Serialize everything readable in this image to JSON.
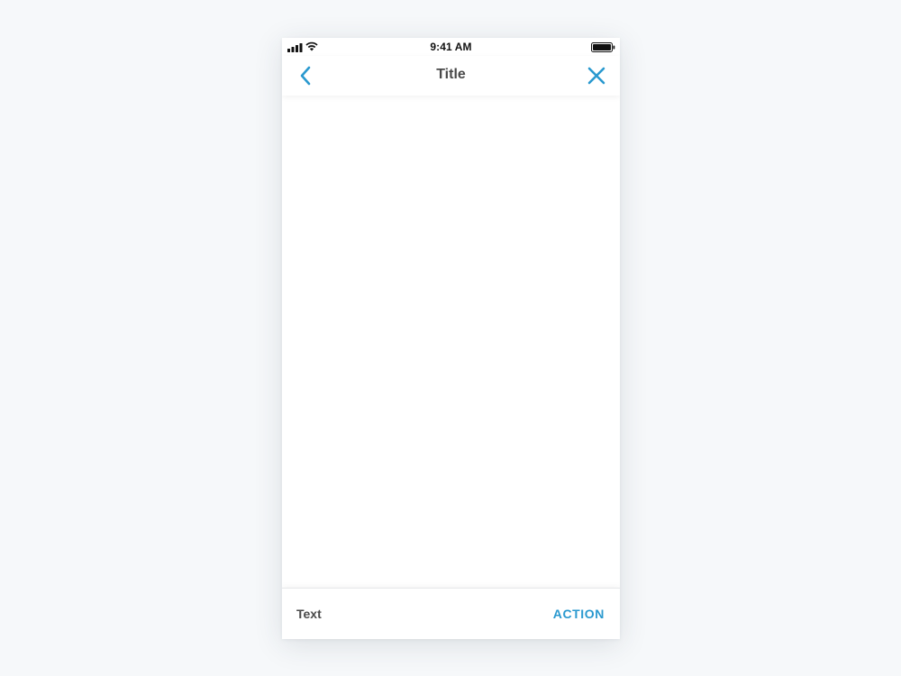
{
  "status_bar": {
    "time": "9:41 AM",
    "signal_icon": "cellular-signal-icon",
    "wifi_icon": "wifi-icon",
    "battery_icon": "battery-icon",
    "battery_level": 1.0
  },
  "nav_bar": {
    "title": "Title",
    "back_icon": "chevron-left-icon",
    "close_icon": "close-icon"
  },
  "bottom_bar": {
    "text": "Text",
    "action_label": "ACTION"
  },
  "colors": {
    "accent": "#2a99cf",
    "title_text": "#4a4a4a",
    "background": "#f6f8fa",
    "surface": "#ffffff"
  }
}
